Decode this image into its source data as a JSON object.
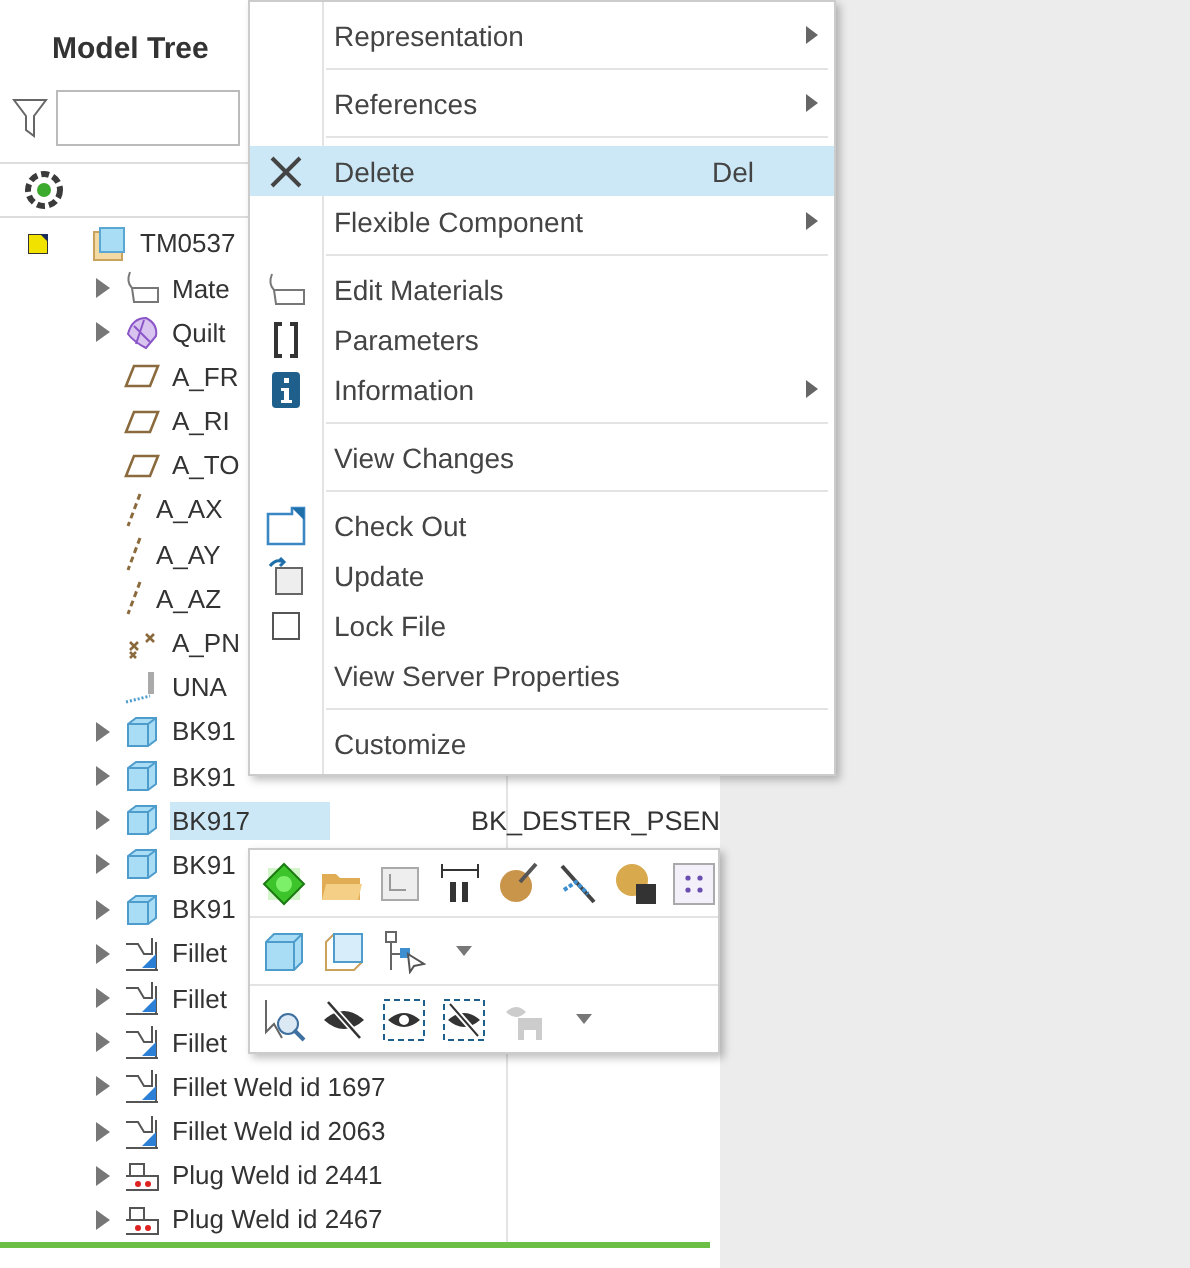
{
  "panel": {
    "title": "Model Tree"
  },
  "tree": [
    {
      "label": "TM0537",
      "kind": "assembly",
      "status": true,
      "children": [
        {
          "label": "Mate",
          "kind": "material",
          "expanded": false
        },
        {
          "label": "Quilt",
          "kind": "quilt",
          "expanded": false
        },
        {
          "label": "A_FR",
          "kind": "plane"
        },
        {
          "label": "A_RI",
          "kind": "plane"
        },
        {
          "label": "A_TO",
          "kind": "plane"
        },
        {
          "label": "A_AX",
          "kind": "axis"
        },
        {
          "label": "A_AY",
          "kind": "axis"
        },
        {
          "label": "A_AZ",
          "kind": "axis"
        },
        {
          "label": "A_PN",
          "kind": "points"
        },
        {
          "label": "UNA",
          "kind": "unassigned"
        },
        {
          "label": "BK91",
          "kind": "part",
          "expanded": false,
          "selected": false
        },
        {
          "label": "BK91",
          "kind": "part",
          "expanded": false,
          "selected": false
        },
        {
          "label": "BK917",
          "kind": "part",
          "expanded": false,
          "selected": true,
          "column_2": "BK_DESTER_PSEN"
        },
        {
          "label": "BK91",
          "kind": "part",
          "expanded": false,
          "selected": false
        },
        {
          "label": "BK91",
          "kind": "part",
          "expanded": false,
          "selected": false
        },
        {
          "label": "Fillet",
          "kind": "fillet",
          "expanded": false
        },
        {
          "label": "Fillet",
          "kind": "fillet",
          "expanded": false
        },
        {
          "label": "Fillet",
          "kind": "fillet",
          "expanded": false
        },
        {
          "label": "Fillet Weld id 1697",
          "kind": "fillet",
          "expanded": false
        },
        {
          "label": "Fillet Weld id 2063",
          "kind": "fillet",
          "expanded": false
        },
        {
          "label": "Plug Weld id 2441",
          "kind": "plug",
          "expanded": false
        },
        {
          "label": "Plug Weld id 2467",
          "kind": "plug",
          "expanded": false
        }
      ]
    }
  ],
  "context_menu": [
    {
      "kind": "item",
      "label": "Representation",
      "submenu": true
    },
    {
      "kind": "separator"
    },
    {
      "kind": "item",
      "label": "References",
      "submenu": true
    },
    {
      "kind": "separator"
    },
    {
      "kind": "item",
      "label": "Delete",
      "shortcut": "Del",
      "selected": true
    },
    {
      "kind": "item",
      "label": "Flexible Component",
      "submenu": true,
      "selected": false
    },
    {
      "kind": "separator"
    },
    {
      "kind": "item",
      "label": "Edit Materials"
    },
    {
      "kind": "item",
      "label": "Parameters"
    },
    {
      "kind": "item",
      "label": "Information",
      "submenu": true
    },
    {
      "kind": "separator"
    },
    {
      "kind": "item",
      "label": "View Changes"
    },
    {
      "kind": "separator"
    },
    {
      "kind": "item",
      "label": "Check Out"
    },
    {
      "kind": "item",
      "label": "Update"
    },
    {
      "kind": "item",
      "label": "Lock File"
    },
    {
      "kind": "item",
      "label": "View Server Properties"
    },
    {
      "kind": "separator"
    },
    {
      "kind": "item",
      "label": "Customize"
    }
  ]
}
